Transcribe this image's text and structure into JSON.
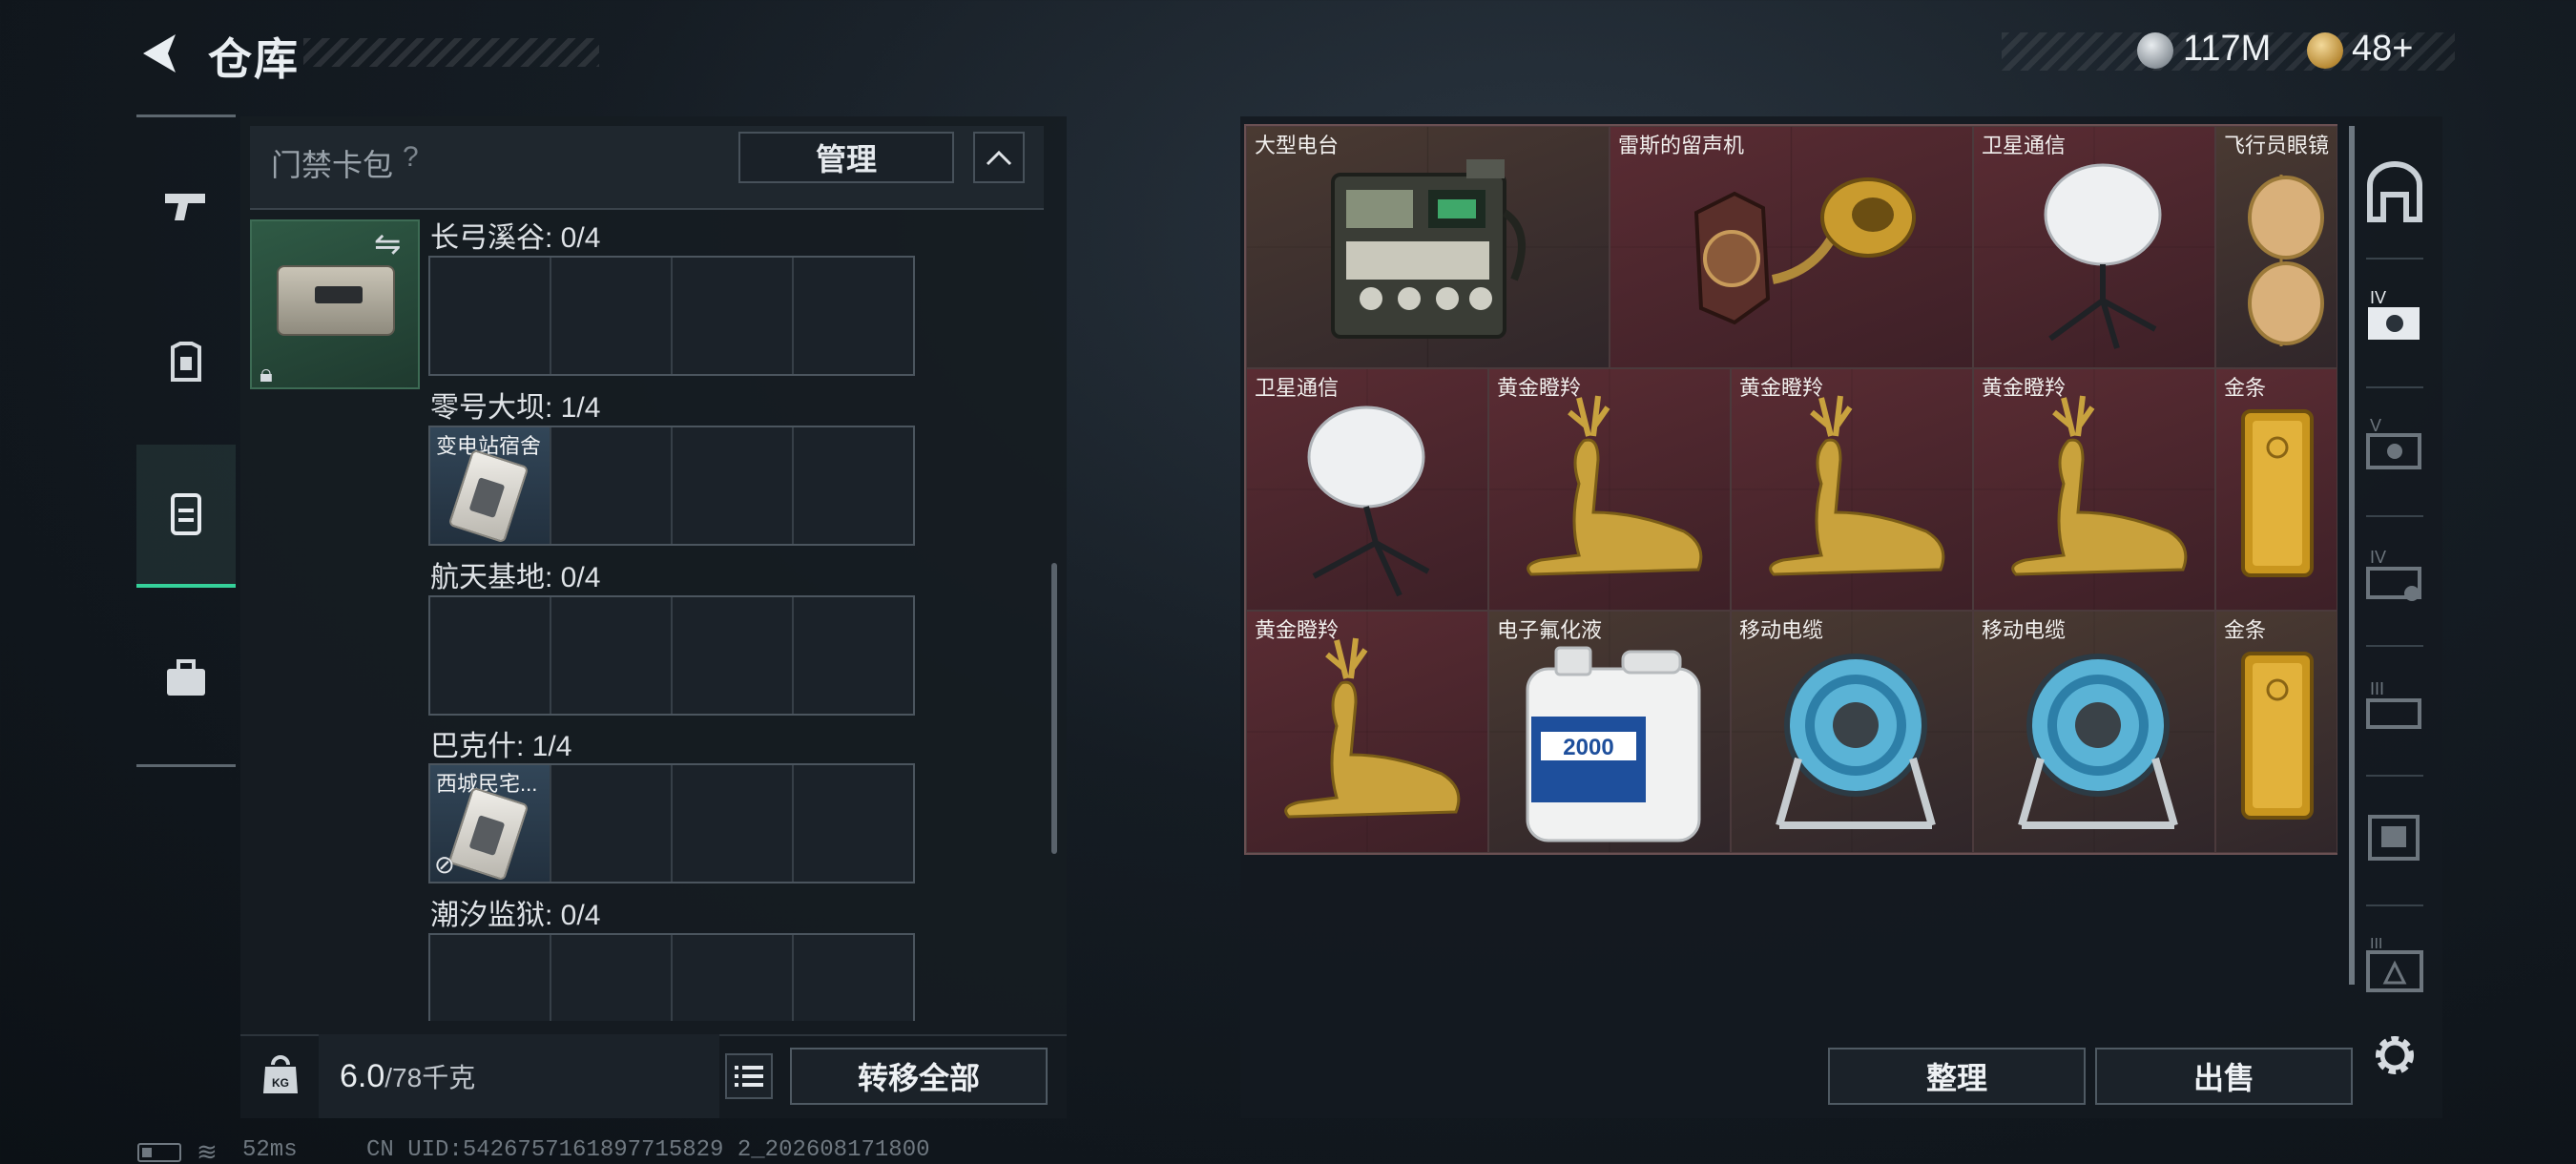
{
  "header": {
    "title": "仓库",
    "currency_silver": "117M",
    "currency_gold": "48+"
  },
  "left_panel": {
    "header_label": "门禁卡包",
    "help": "?",
    "manage_label": "管理",
    "maps": [
      {
        "label": "长弓溪谷: 0/4",
        "card": ""
      },
      {
        "label": "零号大坝: 1/4",
        "card": "变电站宿舍"
      },
      {
        "label": "航天基地: 0/4",
        "card": ""
      },
      {
        "label": "巴克什: 1/4",
        "card": "西城民宅..."
      },
      {
        "label": "潮汐监狱: 0/4",
        "card": ""
      }
    ],
    "weight_current": "6.0",
    "weight_max": "/78千克",
    "kg_label": "KG",
    "transfer_all_label": "转移全部"
  },
  "items": [
    {
      "name": "大型电台",
      "color": "brown",
      "icon": "radio-icon"
    },
    {
      "name": "雷斯的留声机",
      "color": "red",
      "icon": "gramophone-icon"
    },
    {
      "name": "卫星通信",
      "color": "red",
      "icon": "satellite-dish-icon"
    },
    {
      "name": "飞行员眼镜",
      "color": "brown",
      "icon": "aviator-glasses-icon"
    },
    {
      "name": "卫星通信",
      "color": "red",
      "icon": "satellite-dish-icon"
    },
    {
      "name": "黄金瞪羚",
      "color": "red",
      "icon": "gold-gazelle-icon"
    },
    {
      "name": "黄金瞪羚",
      "color": "red",
      "icon": "gold-gazelle-icon"
    },
    {
      "name": "黄金瞪羚",
      "color": "red",
      "icon": "gold-gazelle-icon"
    },
    {
      "name": "金条",
      "color": "red",
      "icon": "gold-bar-icon"
    },
    {
      "name": "黄金瞪羚",
      "color": "red",
      "icon": "gold-gazelle-icon"
    },
    {
      "name": "电子氟化液",
      "color": "brown",
      "icon": "fluid-jug-icon"
    },
    {
      "name": "移动电缆",
      "color": "brown",
      "icon": "cable-reel-icon"
    },
    {
      "name": "移动电缆",
      "color": "brown",
      "icon": "cable-reel-icon"
    },
    {
      "name": "金条",
      "color": "brown",
      "icon": "gold-bar-icon"
    }
  ],
  "jug_label": "2000",
  "right_panel": {
    "sort_label": "整理",
    "sell_label": "出售"
  },
  "status_bar": {
    "ping": "52ms",
    "uid": "CN UID:5426757161897715829 2_202608171800"
  },
  "colors": {
    "accent_green": "#35d19a",
    "item_red": "#5a2c33",
    "item_brown": "#4a3a32"
  }
}
